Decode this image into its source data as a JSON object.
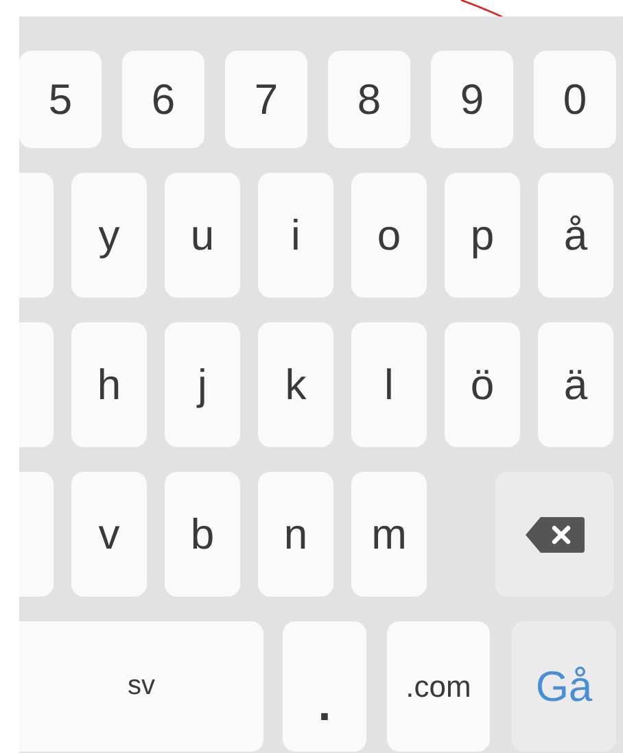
{
  "keyboard": {
    "rows": [
      {
        "keys": [
          {
            "kind": "char",
            "label": "5"
          },
          {
            "kind": "char",
            "label": "6"
          },
          {
            "kind": "char",
            "label": "7"
          },
          {
            "kind": "char",
            "label": "8"
          },
          {
            "kind": "char",
            "label": "9"
          },
          {
            "kind": "char",
            "label": "0"
          }
        ]
      },
      {
        "keys": [
          {
            "kind": "partial"
          },
          {
            "kind": "char",
            "label": "y"
          },
          {
            "kind": "char",
            "label": "u"
          },
          {
            "kind": "char",
            "label": "i"
          },
          {
            "kind": "char",
            "label": "o"
          },
          {
            "kind": "char",
            "label": "p"
          },
          {
            "kind": "char",
            "label": "å"
          }
        ]
      },
      {
        "keys": [
          {
            "kind": "partial"
          },
          {
            "kind": "char",
            "label": "h"
          },
          {
            "kind": "char",
            "label": "j"
          },
          {
            "kind": "char",
            "label": "k"
          },
          {
            "kind": "char",
            "label": "l"
          },
          {
            "kind": "char",
            "label": "ö"
          },
          {
            "kind": "char",
            "label": "ä"
          }
        ]
      },
      {
        "keys": [
          {
            "kind": "partial"
          },
          {
            "kind": "char",
            "label": "v"
          },
          {
            "kind": "char",
            "label": "b"
          },
          {
            "kind": "char",
            "label": "n"
          },
          {
            "kind": "char",
            "label": "m"
          },
          {
            "kind": "backspace"
          }
        ]
      },
      {
        "keys": [
          {
            "kind": "space",
            "label": "sv"
          },
          {
            "kind": "dot",
            "label": "."
          },
          {
            "kind": "domain",
            "label": ".com"
          },
          {
            "kind": "action",
            "label": "Gå"
          }
        ]
      }
    ]
  }
}
